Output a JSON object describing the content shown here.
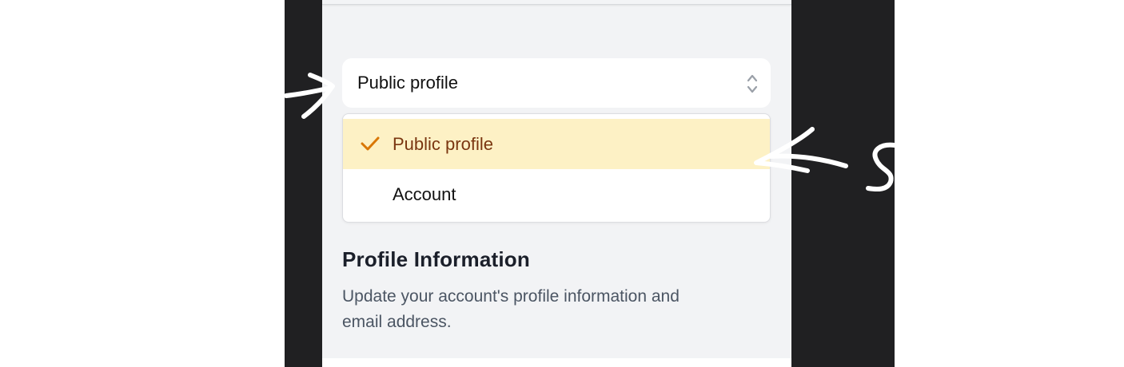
{
  "select": {
    "value": "Public profile",
    "icon": "chevron-up-down-icon"
  },
  "dropdown": {
    "options": [
      {
        "label": "Public profile",
        "selected": true
      },
      {
        "label": "Account",
        "selected": false
      }
    ]
  },
  "section": {
    "title": "Profile Information",
    "description": "Update your account's profile information and email address."
  },
  "colors": {
    "accent": "#d97706",
    "selected_bg": "#fdf1c5",
    "selected_text": "#7a3610",
    "frame": "#202022",
    "panel": "#f2f3f5"
  }
}
